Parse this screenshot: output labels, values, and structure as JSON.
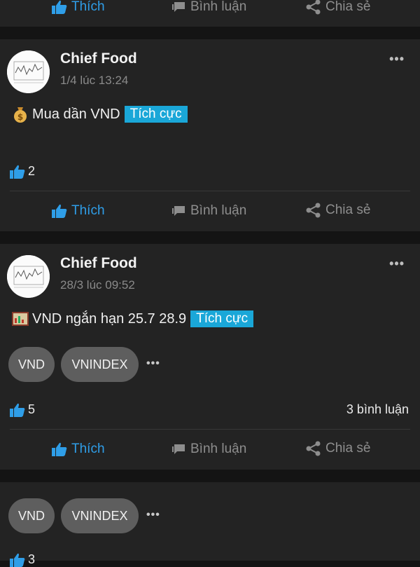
{
  "top_actions": {
    "like": "Thích",
    "comment": "Bình luận",
    "share": "Chia sẻ"
  },
  "posts": [
    {
      "author": "Chief Food",
      "time": "1/4 lúc 13:24",
      "text": "Mua dần VND",
      "sentiment": "Tích cực",
      "likes": "2",
      "actions": {
        "like": "Thích",
        "comment": "Bình luận",
        "share": "Chia sẻ"
      }
    },
    {
      "author": "Chief Food",
      "time": "28/3 lúc 09:52",
      "text": "VND ngắn hạn 25.7 28.9",
      "sentiment": "Tích cực",
      "tags": [
        "VND",
        "VNINDEX"
      ],
      "likes": "5",
      "comments": "3 bình luận",
      "actions": {
        "like": "Thích",
        "comment": "Bình luận",
        "share": "Chia sẻ"
      }
    },
    {
      "tags": [
        "VND",
        "VNINDEX"
      ],
      "likes": "3"
    }
  ],
  "more_label": "•••",
  "colors": {
    "accent": "#2f9ee8",
    "sentiment_bg": "#1aa7d8",
    "card_bg": "#232323",
    "page_bg": "#141414",
    "tag_bg": "#5e5e5e"
  }
}
